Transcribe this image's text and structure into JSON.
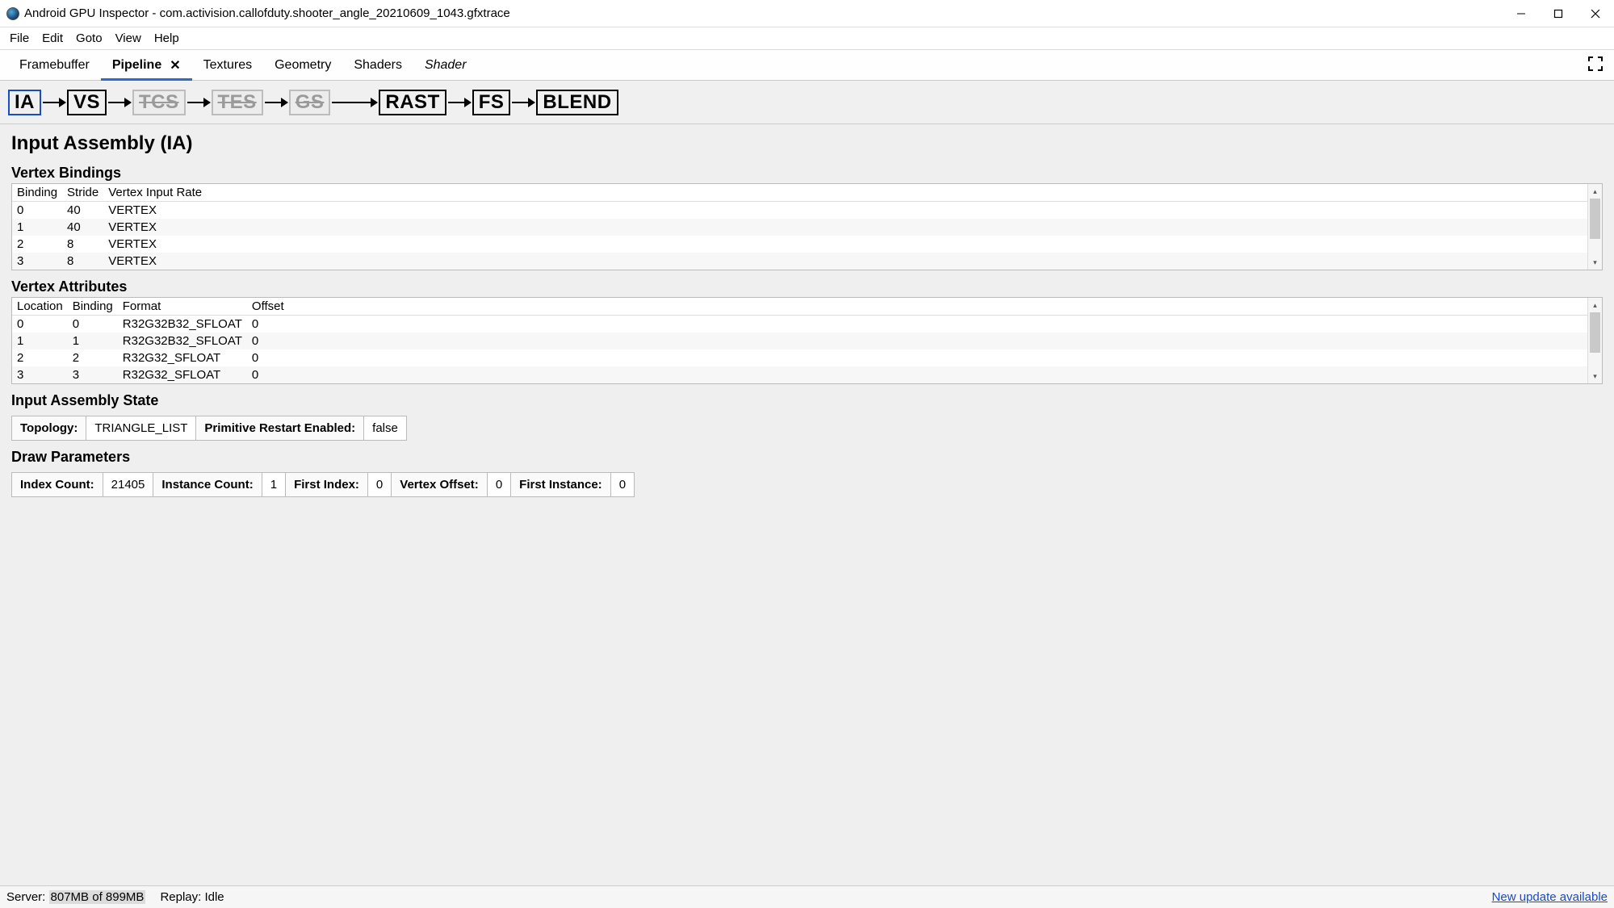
{
  "window": {
    "title": "Android GPU Inspector - com.activision.callofduty.shooter_angle_20210609_1043.gfxtrace"
  },
  "menu": {
    "items": [
      "File",
      "Edit",
      "Goto",
      "View",
      "Help"
    ]
  },
  "tabs": {
    "items": [
      {
        "label": "Framebuffer",
        "active": false,
        "closable": false
      },
      {
        "label": "Pipeline",
        "active": true,
        "closable": true
      },
      {
        "label": "Textures",
        "active": false,
        "closable": false
      },
      {
        "label": "Geometry",
        "active": false,
        "closable": false
      },
      {
        "label": "Shaders",
        "active": false,
        "closable": false
      },
      {
        "label": "Shader",
        "active": false,
        "italic": true
      }
    ]
  },
  "stages": {
    "items": [
      {
        "code": "IA",
        "state": "selected"
      },
      {
        "code": "VS",
        "state": "normal"
      },
      {
        "code": "TCS",
        "state": "disabled"
      },
      {
        "code": "TES",
        "state": "disabled"
      },
      {
        "code": "GS",
        "state": "disabled"
      },
      {
        "code": "RAST",
        "state": "normal"
      },
      {
        "code": "FS",
        "state": "normal"
      },
      {
        "code": "BLEND",
        "state": "normal"
      }
    ]
  },
  "panel": {
    "title": "Input Assembly (IA)",
    "bindings_heading": "Vertex Bindings",
    "attributes_heading": "Vertex Attributes",
    "ia_state_heading": "Input Assembly State",
    "draw_params_heading": "Draw Parameters"
  },
  "bindings": {
    "headers": [
      "Binding",
      "Stride",
      "Vertex Input Rate"
    ],
    "rows": [
      {
        "c0": "0",
        "c1": "40",
        "c2": "VERTEX"
      },
      {
        "c0": "1",
        "c1": "40",
        "c2": "VERTEX"
      },
      {
        "c0": "2",
        "c1": "8",
        "c2": "VERTEX"
      },
      {
        "c0": "3",
        "c1": "8",
        "c2": "VERTEX"
      }
    ]
  },
  "attributes": {
    "headers": [
      "Location",
      "Binding",
      "Format",
      "Offset"
    ],
    "rows": [
      {
        "c0": "0",
        "c1": "0",
        "c2": "R32G32B32_SFLOAT",
        "c3": "0"
      },
      {
        "c0": "1",
        "c1": "1",
        "c2": "R32G32B32_SFLOAT",
        "c3": "0"
      },
      {
        "c0": "2",
        "c1": "2",
        "c2": "R32G32_SFLOAT",
        "c3": "0"
      },
      {
        "c0": "3",
        "c1": "3",
        "c2": "R32G32_SFLOAT",
        "c3": "0"
      }
    ]
  },
  "ia_state": {
    "topology_label": "Topology:",
    "topology_value": "TRIANGLE_LIST",
    "restart_label": "Primitive Restart Enabled:",
    "restart_value": "false"
  },
  "draw": {
    "index_count_label": "Index Count:",
    "index_count_value": "21405",
    "instance_count_label": "Instance Count:",
    "instance_count_value": "1",
    "first_index_label": "First Index:",
    "first_index_value": "0",
    "vertex_offset_label": "Vertex Offset:",
    "vertex_offset_value": "0",
    "first_instance_label": "First Instance:",
    "first_instance_value": "0"
  },
  "status": {
    "server_label": "Server:",
    "server_value": "807MB of 899MB",
    "replay_label": "Replay:",
    "replay_value": "Idle",
    "update_link": "New update available"
  }
}
